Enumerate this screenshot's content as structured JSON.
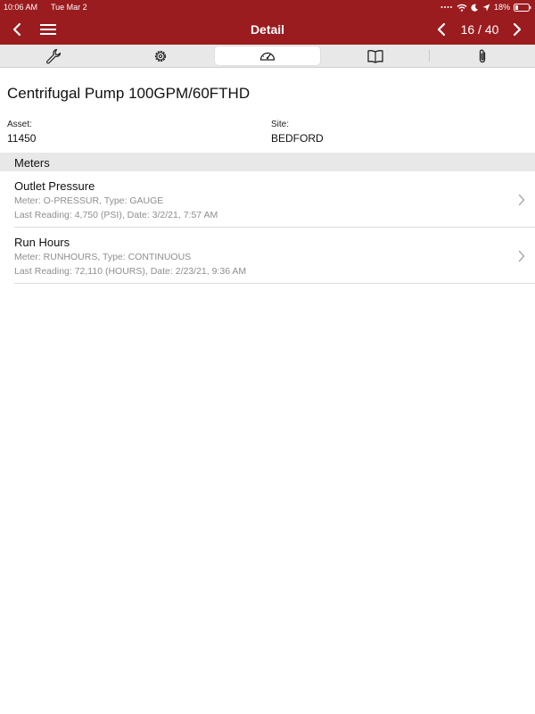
{
  "status_bar": {
    "time": "10:06 AM",
    "date": "Tue Mar 2",
    "battery": "18%"
  },
  "nav": {
    "title": "Detail",
    "counter": "16 / 40"
  },
  "tabs": [
    {
      "icon": "wrench-icon",
      "active": false
    },
    {
      "icon": "gear-icon",
      "active": false
    },
    {
      "icon": "gauge-icon",
      "active": true
    },
    {
      "icon": "book-icon",
      "active": false
    },
    {
      "icon": "paperclip-icon",
      "active": false
    }
  ],
  "asset": {
    "title": "Centrifugal Pump 100GPM/60FTHD",
    "asset_label": "Asset:",
    "asset_value": "11450",
    "site_label": "Site:",
    "site_value": "BEDFORD"
  },
  "meters": {
    "section_title": "Meters",
    "items": [
      {
        "name": "Outlet Pressure",
        "detail": "Meter: O-PRESSUR, Type: GAUGE",
        "reading": "Last Reading: 4,750 (PSI), Date: 3/2/21, 7:57 AM"
      },
      {
        "name": "Run Hours",
        "detail": "Meter: RUNHOURS, Type: CONTINUOUS",
        "reading": "Last Reading: 72,110 (HOURS), Date: 2/23/21, 9:36 AM"
      }
    ]
  },
  "colors": {
    "header_bg": "#9b1c1f",
    "tabbar_bg": "#e8e8e8",
    "secondary_text": "#8e8e8e"
  }
}
